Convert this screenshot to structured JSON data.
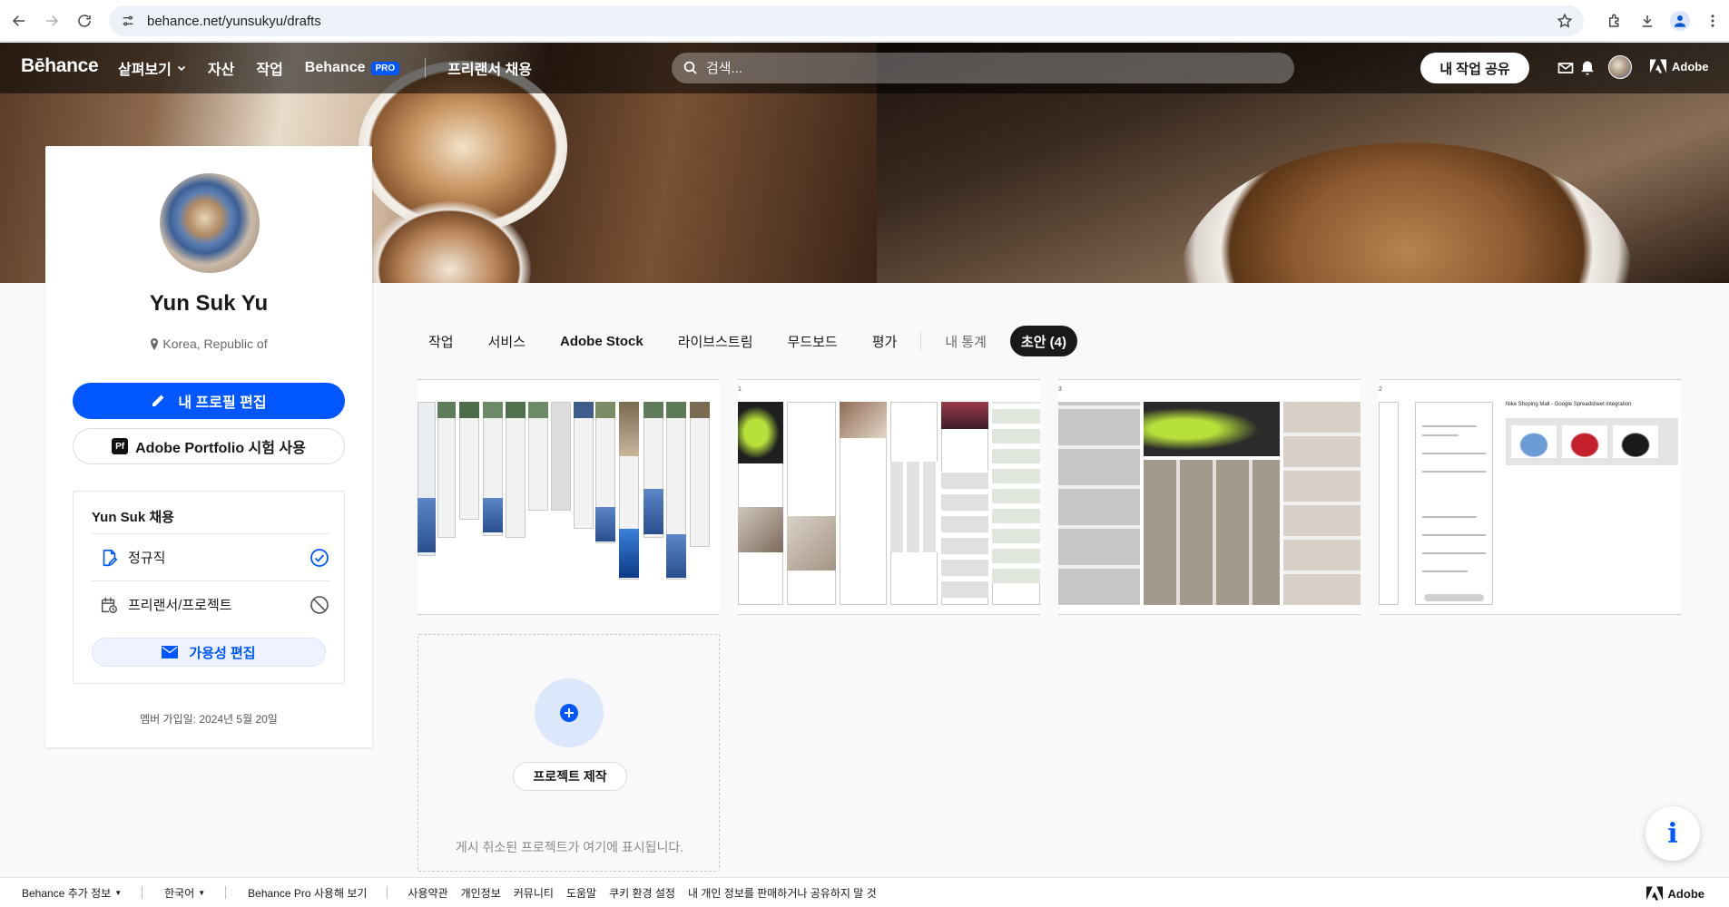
{
  "browser": {
    "url": "behance.net/yunsukyu/drafts"
  },
  "header": {
    "logo": "Bēhance",
    "nav": [
      "샅펴보기",
      "자산",
      "작업"
    ],
    "behance_label": "Behance",
    "pro_badge": "PRO",
    "freelancer": "프리랜서 채용",
    "search_placeholder": "검색...",
    "share_button": "내 작업 공유",
    "adobe_label": "Adobe"
  },
  "profile": {
    "name": "Yun Suk Yu",
    "location": "Korea, Republic of",
    "edit_button": "내 프로필 편집",
    "portfolio_icon": "Pf",
    "portfolio_button": "Adobe Portfolio 시험 사용",
    "hire_title": "Yun Suk 채용",
    "hire_rows": [
      {
        "label": "정규직",
        "icon": "edit-document-icon",
        "status": "checked"
      },
      {
        "label": "프리랜서/프로젝트",
        "icon": "calendar-clock-icon",
        "status": "disabled"
      }
    ],
    "availability_button": "가용성 편집",
    "member_since": "멤버 가입일: 2024년 5월 20일"
  },
  "tabs": [
    {
      "label": "작업",
      "state": "normal"
    },
    {
      "label": "서비스",
      "state": "normal"
    },
    {
      "label": "Adobe Stock",
      "state": "bold"
    },
    {
      "label": "라이브스트림",
      "state": "normal"
    },
    {
      "label": "무드보드",
      "state": "normal"
    },
    {
      "label": "평가",
      "state": "normal"
    },
    {
      "label": "내 통계",
      "state": "muted"
    },
    {
      "label": "초안 (4)",
      "state": "active"
    }
  ],
  "drafts": [
    {
      "label": ""
    },
    {
      "label": "1"
    },
    {
      "label": "3"
    },
    {
      "label": "2"
    }
  ],
  "draft4_caption": "Nike Shoping Mall - Google Spreadsheet integration",
  "new_project": {
    "create_button": "프로젝트 제작",
    "hint": "게시 취소된 프로젝트가 여기에 표시됩니다."
  },
  "info_fab": "i",
  "footer": {
    "items": [
      "Behance 추가 정보",
      "한국어",
      "Behance Pro 사용해 보기"
    ],
    "links": [
      "사용약관",
      "개인정보",
      "커뮤니티",
      "도움말",
      "쿠키 환경 설정",
      "내 개인 정보를 판매하거나 공유하지 말 것"
    ],
    "adobe": "Adobe"
  },
  "colors": {
    "accent": "#0057ff",
    "active_tab": "#191919",
    "background": "#f9f9f9"
  }
}
